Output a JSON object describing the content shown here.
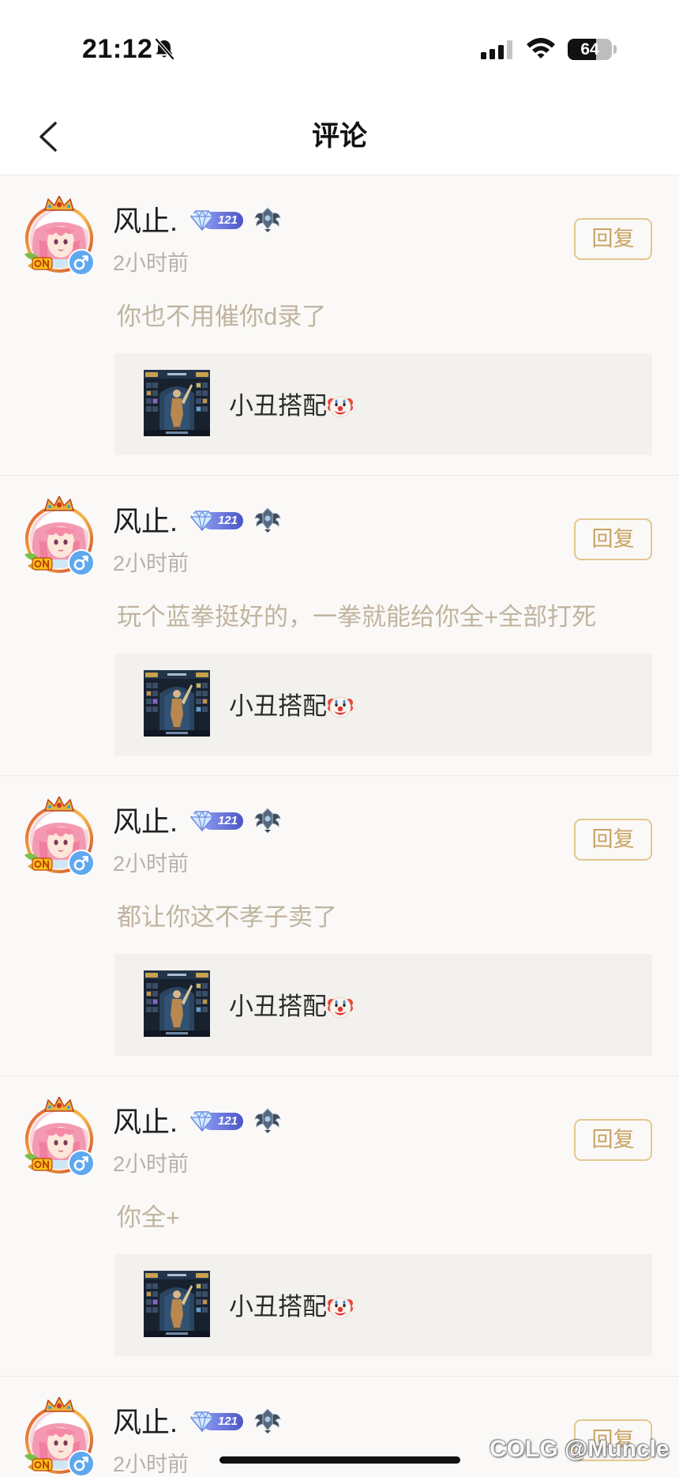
{
  "status_bar": {
    "time": "21:12",
    "battery": "64",
    "icons": [
      "bell-slash-icon",
      "cellular-signal-icon",
      "wifi-icon",
      "battery-icon"
    ]
  },
  "header": {
    "title": "评论",
    "back_icon": "chevron-left-icon"
  },
  "comments": [
    {
      "username": "风止.",
      "level": "121",
      "time": "2小时前",
      "reply_label": "回复",
      "text": "你也不用催你d录了",
      "gender_icon": "male-symbol-icon",
      "ref": {
        "title": "小丑搭配",
        "emoji_icon": "clown-face-icon"
      }
    },
    {
      "username": "风止.",
      "level": "121",
      "time": "2小时前",
      "reply_label": "回复",
      "text": "玩个蓝拳挺好的，一拳就能给你全+全部打死",
      "gender_icon": "male-symbol-icon",
      "ref": {
        "title": "小丑搭配",
        "emoji_icon": "clown-face-icon"
      }
    },
    {
      "username": "风止.",
      "level": "121",
      "time": "2小时前",
      "reply_label": "回复",
      "text": "都让你这不孝子卖了",
      "gender_icon": "male-symbol-icon",
      "ref": {
        "title": "小丑搭配",
        "emoji_icon": "clown-face-icon"
      }
    },
    {
      "username": "风止.",
      "level": "121",
      "time": "2小时前",
      "reply_label": "回复",
      "text": "你全+",
      "gender_icon": "male-symbol-icon",
      "ref": {
        "title": "小丑搭配",
        "emoji_icon": "clown-face-icon"
      }
    },
    {
      "username": "风止.",
      "level": "121",
      "time": "2小时前",
      "reply_label": "回复",
      "gender_icon": "male-symbol-icon"
    }
  ],
  "watermark": {
    "text": "COLG @Muncle"
  },
  "colors": {
    "page_bg": "#faf9f7",
    "card_bg": "#f3f1ee",
    "reply_text": "#c9a262",
    "reply_border": "#e4c78e",
    "comment_text": "#c0b49f",
    "time_text": "#b5b2ac",
    "gender_badge": "#5ea8f0",
    "level_badge": "#5d6be0"
  }
}
